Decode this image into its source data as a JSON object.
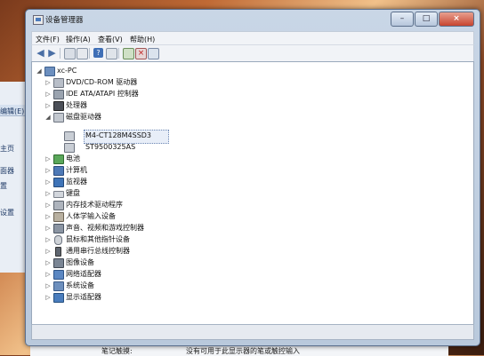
{
  "background_left": {
    "items": [
      "编辑(E)",
      "主页",
      "面器",
      "置",
      "设置"
    ]
  },
  "background_bottom": {
    "left_text": "笔记触摸:",
    "right_text": "没有可用于此显示器的笔或触控输入"
  },
  "window": {
    "title": "设备管理器",
    "controls": {
      "minimize": "–",
      "maximize": "□",
      "close": "×"
    }
  },
  "menu": {
    "file": "文件(F)",
    "action": "操作(A)",
    "view": "查看(V)",
    "help": "帮助(H)"
  },
  "toolbar": {
    "icons": [
      "back-icon",
      "forward-icon",
      "show-hide-icon",
      "properties-icon",
      "help-icon",
      "scan-icon",
      "update-driver-icon",
      "uninstall-icon",
      "disable-icon"
    ]
  },
  "tree": {
    "root": "xc-PC",
    "categories": [
      {
        "label": "DVD/CD-ROM 驱动器",
        "expanded": false
      },
      {
        "label": "IDE ATA/ATAPI 控制器",
        "expanded": false
      },
      {
        "label": "处理器",
        "expanded": false
      },
      {
        "label": "磁盘驱动器",
        "expanded": true,
        "children": [
          "M4-CT128M4SSD3",
          "ST9500325AS"
        ]
      },
      {
        "label": "电池",
        "expanded": false
      },
      {
        "label": "计算机",
        "expanded": false
      },
      {
        "label": "监视器",
        "expanded": false
      },
      {
        "label": "键盘",
        "expanded": false
      },
      {
        "label": "内存技术驱动程序",
        "expanded": false
      },
      {
        "label": "人体学输入设备",
        "expanded": false
      },
      {
        "label": "声音、视频和游戏控制器",
        "expanded": false
      },
      {
        "label": "鼠标和其他指针设备",
        "expanded": false
      },
      {
        "label": "通用串行总线控制器",
        "expanded": false
      },
      {
        "label": "图像设备",
        "expanded": false
      },
      {
        "label": "网络适配器",
        "expanded": false
      },
      {
        "label": "系统设备",
        "expanded": false
      },
      {
        "label": "显示适配器",
        "expanded": false
      }
    ],
    "selected": "M4-CT128M4SSD3"
  }
}
